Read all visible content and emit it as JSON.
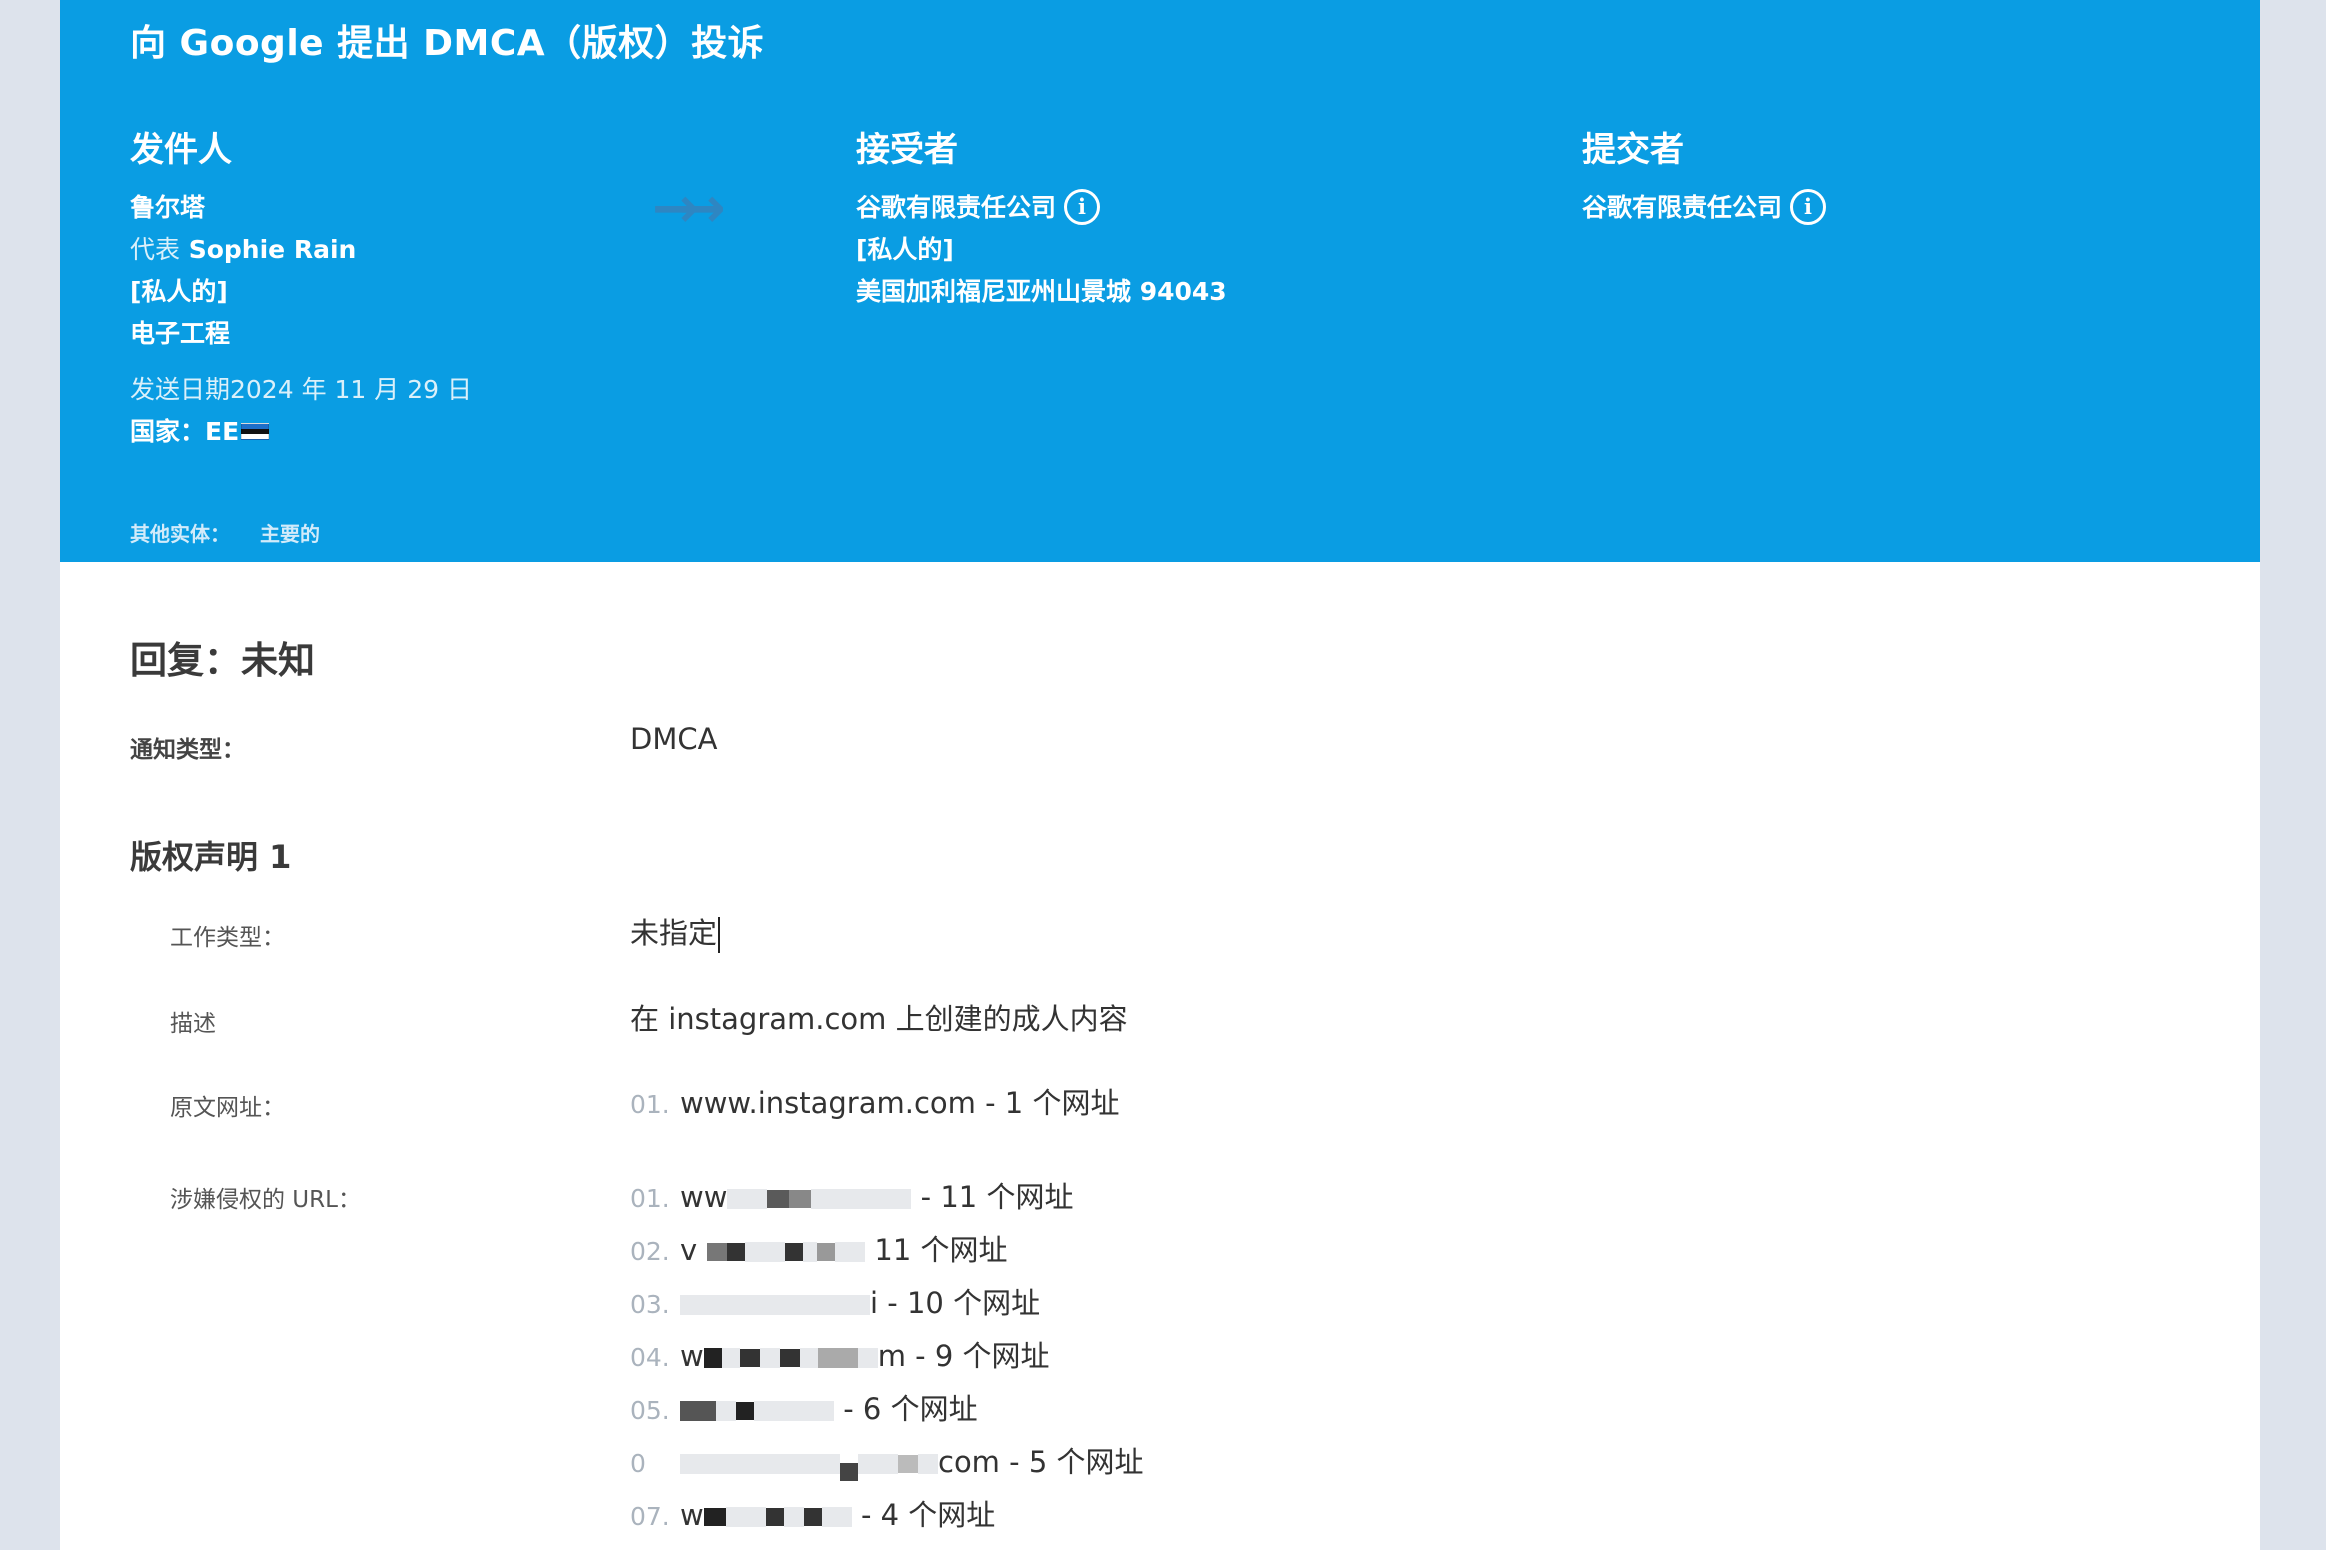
{
  "header": {
    "title": "向 Google 提出 DMCA（版权）投诉",
    "sender": {
      "heading": "发件人",
      "name": "鲁尔塔",
      "on_behalf_prefix": "代表",
      "on_behalf_name": "Sophie Rain",
      "private": "[私人的]",
      "org": "电子工程",
      "sent_date": "发送日期2024 年 11 月 29 日",
      "country_label": "国家：",
      "country_code": "EE"
    },
    "recipient": {
      "heading": "接受者",
      "name": "谷歌有限责任公司",
      "private": "[私人的]",
      "address": "美国加利福尼亚州山景城 94043"
    },
    "submitter": {
      "heading": "提交者",
      "name": "谷歌有限责任公司"
    },
    "other_entities_label": "其他实体：",
    "other_entities_value": "主要的",
    "colors": {
      "header_bg": "#0a9de3",
      "page_bg": "#dde3ec"
    }
  },
  "main": {
    "reply": "回复：未知",
    "notice_type_label": "通知类型：",
    "notice_type_value": "DMCA",
    "claim_heading": "版权声明 1",
    "work_type_label": "工作类型：",
    "work_type_value": "未指定",
    "description_label": "描述",
    "description_value": "在 instagram.com 上创建的成人内容",
    "original_urls_label": "原文网址：",
    "original_urls": [
      {
        "num": "01.",
        "text": "www.instagram.com - 1 个网址"
      }
    ],
    "infringing_label": "涉嫌侵权的 URL：",
    "infringing_urls": [
      {
        "num": "01.",
        "prefix": "ww",
        "suffix": "- 11 个网址"
      },
      {
        "num": "02.",
        "prefix": "v",
        "suffix": "11 个网址"
      },
      {
        "num": "03.",
        "prefix": "",
        "suffix": "i - 10 个网址"
      },
      {
        "num": "04.",
        "prefix": "w",
        "suffix": "m - 9 个网址"
      },
      {
        "num": "05.",
        "prefix": "",
        "suffix": "- 6 个网址"
      },
      {
        "num": "0",
        "prefix": "",
        "suffix": "com - 5 个网址"
      },
      {
        "num": "07.",
        "prefix": "w",
        "suffix": "- 4 个网址"
      }
    ]
  }
}
